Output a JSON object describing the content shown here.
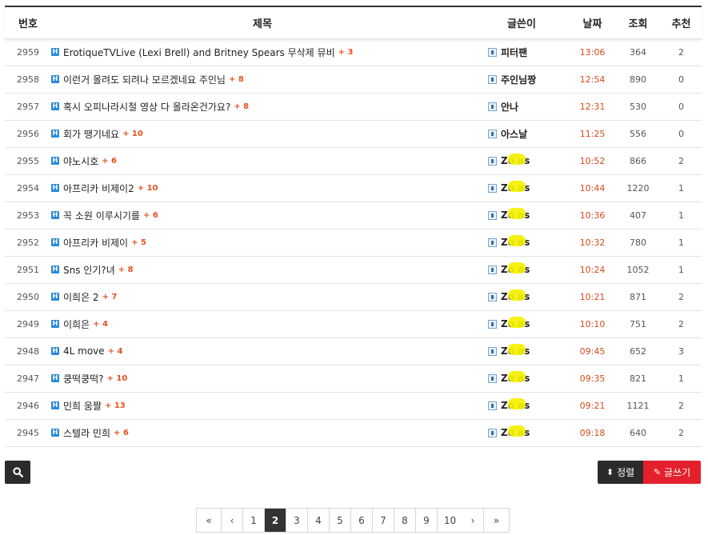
{
  "columns": {
    "num": "번호",
    "subject": "제목",
    "author": "글쓴이",
    "date": "날짜",
    "views": "조회",
    "rec": "추천"
  },
  "badge_label": "H",
  "rows": [
    {
      "num": "2959",
      "title": "ErotiqueTVLive (Lexi Brell) and Britney Spears 무삭제 뮤비",
      "comments": "+ 3",
      "author": "피터팬",
      "redacted": false,
      "date": "13:06",
      "views": "364",
      "rec": "2"
    },
    {
      "num": "2958",
      "title": "이런거 올려도 되려나 모르겠네요 주인님",
      "comments": "+ 8",
      "author": "주인님짱",
      "redacted": false,
      "date": "12:54",
      "views": "890",
      "rec": "0"
    },
    {
      "num": "2957",
      "title": "혹시 오피나라시절 영상 다 올라온건가요?",
      "comments": "+ 8",
      "author": "안나",
      "redacted": false,
      "date": "12:31",
      "views": "530",
      "rec": "0"
    },
    {
      "num": "2956",
      "title": "회가 땡기네요",
      "comments": "+ 10",
      "author": "아스날",
      "redacted": false,
      "date": "11:25",
      "views": "556",
      "rec": "0"
    },
    {
      "num": "2955",
      "title": "야노시호",
      "comments": "+ 6",
      "author": "Zo  as",
      "redacted": true,
      "date": "10:52",
      "views": "866",
      "rec": "2"
    },
    {
      "num": "2954",
      "title": "아프리카 비제이2",
      "comments": "+ 10",
      "author": "Zo  as",
      "redacted": true,
      "date": "10:44",
      "views": "1220",
      "rec": "1"
    },
    {
      "num": "2953",
      "title": "꼭 소원 이루시기를",
      "comments": "+ 6",
      "author": "Zo  as",
      "redacted": true,
      "date": "10:36",
      "views": "407",
      "rec": "1"
    },
    {
      "num": "2952",
      "title": "아프리카 비제이",
      "comments": "+ 5",
      "author": "Zo  as",
      "redacted": true,
      "date": "10:32",
      "views": "780",
      "rec": "1"
    },
    {
      "num": "2951",
      "title": "Sns 인기?녀",
      "comments": "+ 8",
      "author": "Zo  as",
      "redacted": true,
      "date": "10:24",
      "views": "1052",
      "rec": "1"
    },
    {
      "num": "2950",
      "title": "이희은 2",
      "comments": "+ 7",
      "author": "Zo  as",
      "redacted": true,
      "date": "10:21",
      "views": "871",
      "rec": "2"
    },
    {
      "num": "2949",
      "title": "이희은",
      "comments": "+ 4",
      "author": "Zo  as",
      "redacted": true,
      "date": "10:10",
      "views": "751",
      "rec": "2"
    },
    {
      "num": "2948",
      "title": "4L move",
      "comments": "+ 4",
      "author": "Zo  as",
      "redacted": true,
      "date": "09:45",
      "views": "652",
      "rec": "3"
    },
    {
      "num": "2947",
      "title": "쿵떡쿵떡?",
      "comments": "+ 10",
      "author": "Zo  as",
      "redacted": true,
      "date": "09:35",
      "views": "821",
      "rec": "1"
    },
    {
      "num": "2946",
      "title": "민희 움짤",
      "comments": "+ 13",
      "author": "Zo  as",
      "redacted": true,
      "date": "09:21",
      "views": "1121",
      "rec": "2"
    },
    {
      "num": "2945",
      "title": "스텔라 민희",
      "comments": "+ 6",
      "author": "Zo  as",
      "redacted": true,
      "date": "09:18",
      "views": "640",
      "rec": "2"
    }
  ],
  "toolbar": {
    "sort_label": "정렬",
    "write_label": "글쓰기",
    "search_icon": "search-icon",
    "sort_icon": "sort-icon",
    "write_icon": "pencil-icon"
  },
  "pagination": {
    "first": "«",
    "prev": "‹",
    "next": "›",
    "last": "»",
    "pages": [
      "1",
      "2",
      "3",
      "4",
      "5",
      "6",
      "7",
      "8",
      "9",
      "10"
    ],
    "current": "2"
  },
  "colors": {
    "accent_red": "#e3202c",
    "date": "#d9491a",
    "comment": "#e8501f",
    "badge": "#2a8ad8",
    "dark_button": "#2b2b2b"
  }
}
